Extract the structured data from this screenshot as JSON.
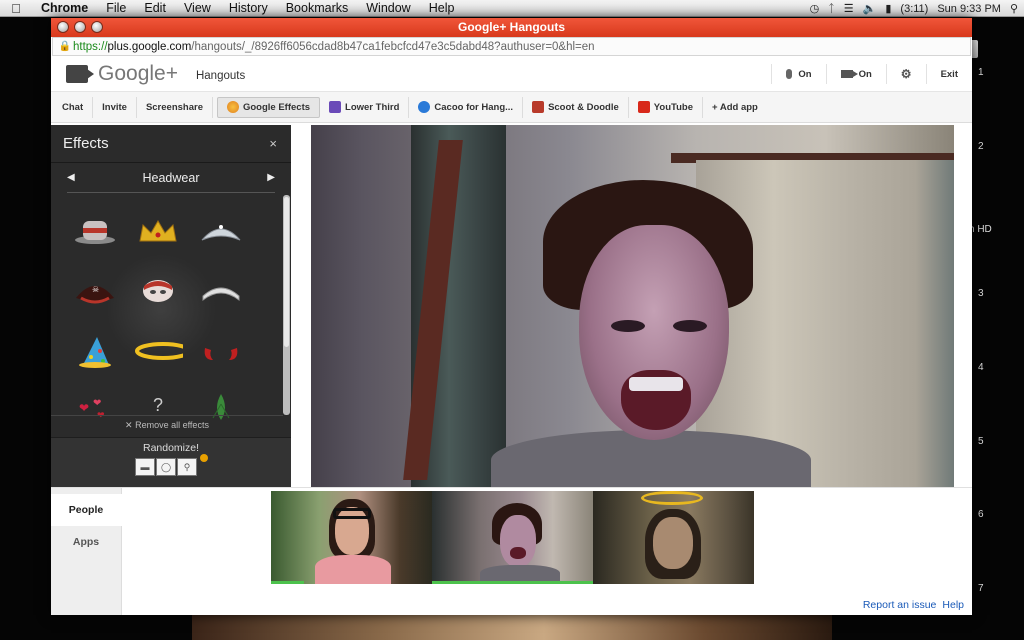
{
  "menubar": {
    "app": "Chrome",
    "items": [
      "File",
      "Edit",
      "View",
      "History",
      "Bookmarks",
      "Window",
      "Help"
    ],
    "battery": "(3:11)",
    "clock": "Sun 9:33 PM"
  },
  "desktop": {
    "side_numbers": [
      "1",
      "2",
      "3",
      "4",
      "5",
      "6",
      "7"
    ],
    "side_label": "h HD"
  },
  "window": {
    "title": "Google+ Hangouts",
    "url_scheme": "https://",
    "url_host": "plus.google.com",
    "url_path": "/hangouts/_/8926ff6056cdad8b47ca1febcfcd47e3c5dabd48?authuser=0&hl=en"
  },
  "gheader": {
    "logo": "Google+",
    "section": "Hangouts",
    "mic_state": "On",
    "camera_state": "On",
    "exit_label": "Exit"
  },
  "apptabs": [
    {
      "label": "Chat"
    },
    {
      "label": "Invite"
    },
    {
      "label": "Screenshare"
    },
    {
      "label": "Google Effects",
      "active": true
    },
    {
      "label": "Lower Third"
    },
    {
      "label": "Cacoo for Hang..."
    },
    {
      "label": "Scoot & Doodle"
    },
    {
      "label": "YouTube"
    },
    {
      "label": "+ Add app"
    }
  ],
  "effects": {
    "title": "Effects",
    "close": "×",
    "category": "Headwear",
    "remove_all": "✕ Remove all effects",
    "randomize_label": "Randomize!",
    "items": [
      "top-hat",
      "crown",
      "tiara",
      "pirate-hat",
      "mask",
      "headband",
      "party-hat",
      "halo",
      "devil-horns",
      "hearts",
      "mystery",
      "leaf-hat"
    ]
  },
  "bottom": {
    "tabs": [
      "People",
      "Apps"
    ],
    "links": [
      "Report an issue",
      "Help"
    ]
  }
}
